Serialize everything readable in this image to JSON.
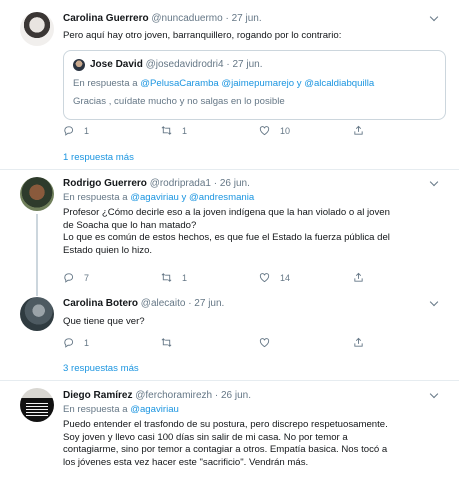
{
  "tweets": [
    {
      "name": "Carolina Guerrero",
      "handle": "@nuncaduermo",
      "date": "· 27 jun.",
      "text": "Pero aquí hay otro joven, barranquillero, rogando por lo contrario:",
      "quote": {
        "name": "Jose David",
        "handle": "@josedavidrodri4",
        "date": "· 27 jun.",
        "reply_prefix": "En respuesta a",
        "reply_to": "@PelusaCaramba @jaimepumarejo y @alcaldiabquilla",
        "text": "Gracias , cuídate mucho y no salgas en lo posible"
      },
      "replies": "1",
      "retweets": "1",
      "likes": "10",
      "more": "1 respuesta más"
    },
    {
      "name": "Rodrigo Guerrero",
      "handle": "@rodriprada1",
      "date": "· 26 jun.",
      "reply_prefix": "En respuesta a",
      "reply_to": "@agaviriau y @andresmania",
      "lines": [
        "Profesor ¿Cómo decirle eso a la joven indígena que la han violado o al joven",
        "de Soacha que lo han matado?",
        "Lo que es  común de estos hechos, es que fue el Estado la fuerza pública del",
        "Estado quien lo hizo."
      ],
      "replies": "7",
      "retweets": "1",
      "likes": "14"
    },
    {
      "name": "Carolina Botero",
      "handle": "@alecaito",
      "date": "· 27 jun.",
      "text": "Que tiene que ver?",
      "replies": "1",
      "retweets": "",
      "likes": "",
      "more": "3 respuestas más"
    },
    {
      "name": "Diego Ramírez",
      "handle": "@ferchoramirezh",
      "date": "· 26 jun.",
      "reply_prefix": "En respuesta a",
      "reply_to": "@agaviriau",
      "lines": [
        "Puedo entender el trasfondo de su postura, pero discrepo respetuosamente.",
        "Soy joven y llevo casi 100 días sin salir de mi casa. No por temor a",
        "contagiarme, sino por temor a contagiar a otros. Empatía basica. Nos tocó a",
        "los jóvenes esta vez hacer este \"sacrificio\". Vendrán más."
      ]
    }
  ],
  "icons": [
    "reply-icon",
    "retweet-icon",
    "like-icon",
    "share-icon",
    "chevron-down-icon"
  ],
  "colors": {
    "link": "#1b95e0",
    "muted": "#657786",
    "border": "#e6ecf0"
  }
}
